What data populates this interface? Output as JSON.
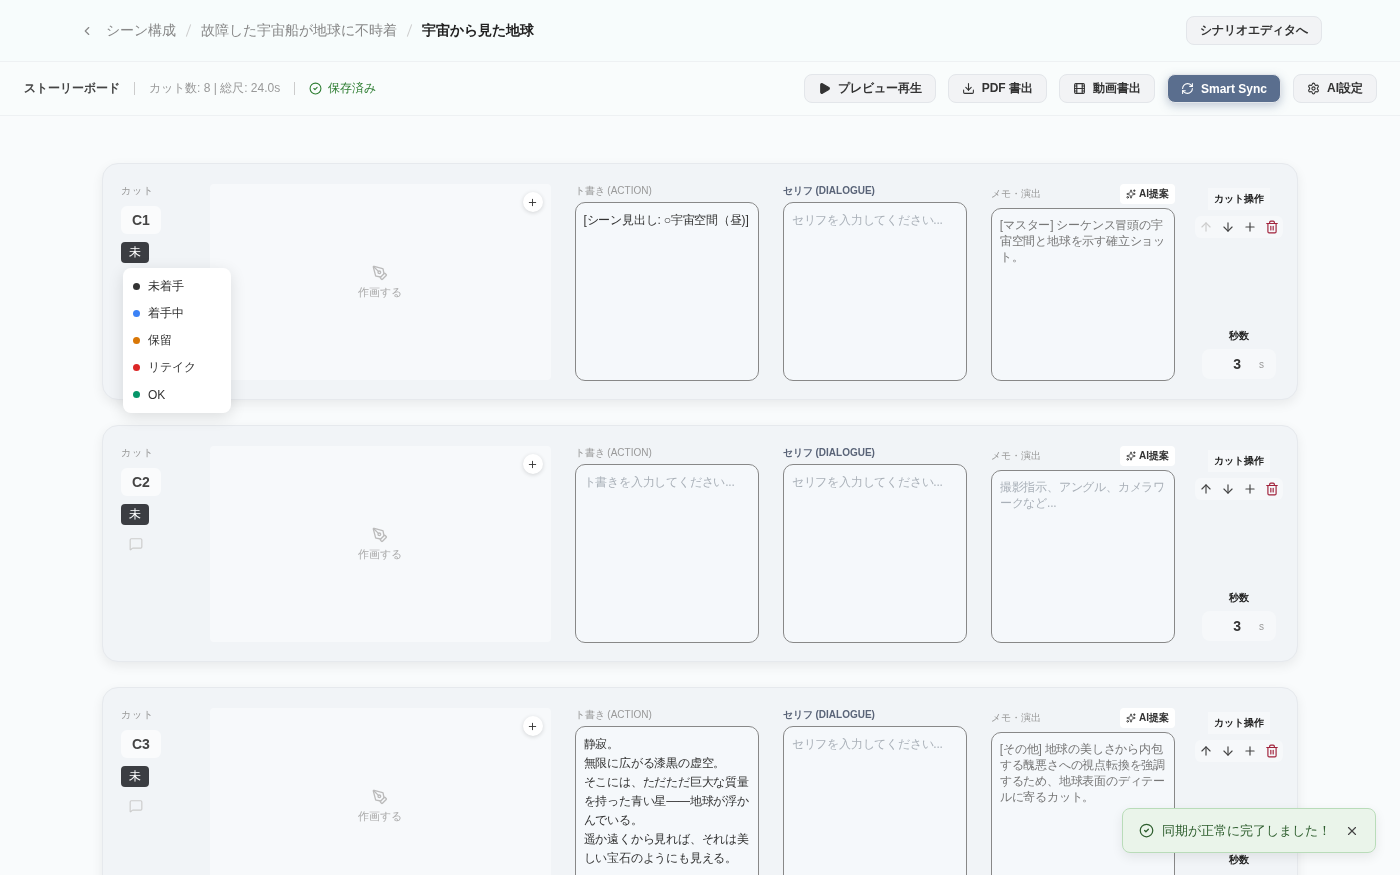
{
  "breadcrumb": {
    "items": [
      "シーン構成",
      "故障した宇宙船が地球に不時着",
      "宇宙から見た地球"
    ],
    "action": "シナリオエディタへ"
  },
  "toolbar": {
    "title": "ストーリーボード",
    "stats": "カット数: 8 | 総尺: 24.0s",
    "save_status": "保存済み",
    "buttons": [
      {
        "kind": "play",
        "label": "プレビュー再生",
        "primary": false
      },
      {
        "kind": "download",
        "label": "PDF 書出",
        "primary": false
      },
      {
        "kind": "film",
        "label": "動画書出",
        "primary": false
      },
      {
        "kind": "sync",
        "label": "Smart Sync",
        "primary": true
      },
      {
        "kind": "settings",
        "label": "AI設定",
        "primary": false
      }
    ]
  },
  "cuts": [
    {
      "label_cut": "カット",
      "id": "C1",
      "status": "未",
      "menu_open": true,
      "draw_label": "作画する",
      "action_label": "ト書き (ACTION)",
      "action": [
        "[シーン見出し: ○宇宙空間（昼)]"
      ],
      "dialogue_label": "セリフ (DIALOGUE)",
      "dialogue_placeholder": "セリフを入力してください...",
      "memo_label": "メモ・演出",
      "memo": "[マスター] シーケンス冒頭の宇宙空間と地球を示す確立ショット。",
      "ai_button": "AI提案",
      "ops_label": "カット操作",
      "up_disabled": true,
      "seconds_label": "秒数",
      "seconds": "3",
      "seconds_unit": "s"
    },
    {
      "label_cut": "カット",
      "id": "C2",
      "status": "未",
      "menu_open": false,
      "draw_label": "作画する",
      "action_label": "ト書き (ACTION)",
      "action_placeholder": "ト書きを入力してください...",
      "dialogue_label": "セリフ (DIALOGUE)",
      "dialogue_placeholder": "セリフを入力してください...",
      "memo_label": "メモ・演出",
      "memo_placeholder": "撮影指示、アングル、カメラワークなど...",
      "ai_button": "AI提案",
      "ops_label": "カット操作",
      "up_disabled": false,
      "seconds_label": "秒数",
      "seconds": "3",
      "seconds_unit": "s"
    },
    {
      "label_cut": "カット",
      "id": "C3",
      "status": "未",
      "menu_open": false,
      "draw_label": "作画する",
      "action_label": "ト書き (ACTION)",
      "action": [
        "静寂。",
        "無限に広がる漆黒の虚空。",
        "そこには、ただただ巨大な質量を持った青い星——地球が浮かんでいる。",
        "遥か遠くから見れば、それは美しい宝石のようにも見える。"
      ],
      "dialogue_label": "セリフ (DIALOGUE)",
      "dialogue_placeholder": "セリフを入力してください...",
      "memo_label": "メモ・演出",
      "memo": "[その他] 地球の美しさから内包する醜悪さへの視点転換を強調するため、地球表面のディテールに寄るカット。",
      "ai_button": "AI提案",
      "ops_label": "カット操作",
      "up_disabled": false,
      "seconds_label": "秒数"
    }
  ],
  "status_menu": [
    {
      "label": "未着手",
      "color": "#333333"
    },
    {
      "label": "着手中",
      "color": "#3b82f6"
    },
    {
      "label": "保留",
      "color": "#d97706"
    },
    {
      "label": "リテイク",
      "color": "#dc2626"
    },
    {
      "label": "OK",
      "color": "#059669"
    }
  ],
  "toast": {
    "message": "同期が正常に完了しました！"
  }
}
